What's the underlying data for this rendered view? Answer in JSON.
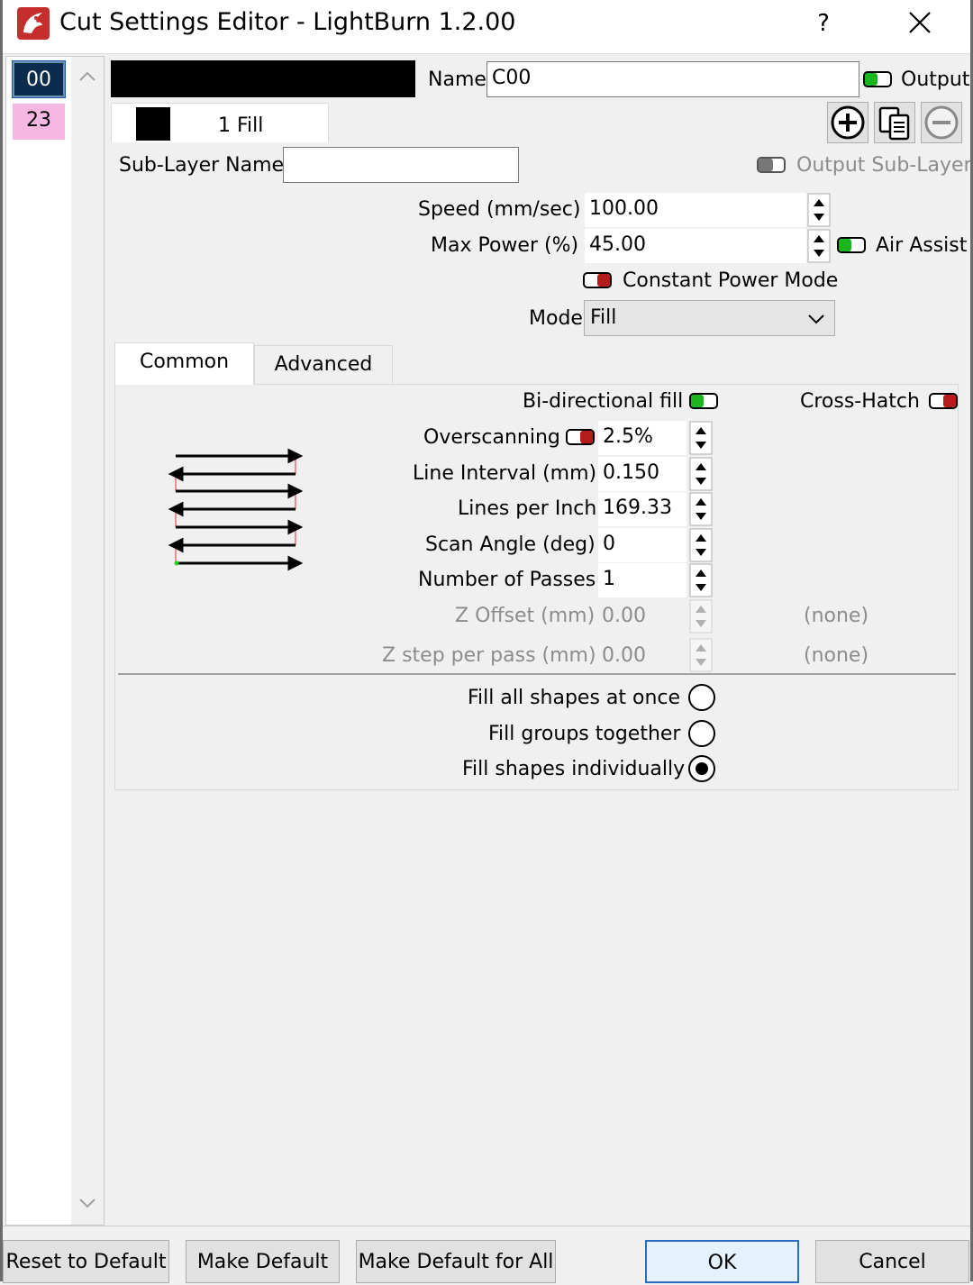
{
  "window": {
    "title": "Cut Settings Editor - LightBurn 1.2.00",
    "help_label": "?"
  },
  "layers": [
    {
      "label": "00",
      "color": "#0c2c4d",
      "selected": true
    },
    {
      "label": "23",
      "color": "#f6b8e3",
      "selected": false
    }
  ],
  "layer_header": {
    "swatch_color": "#000000",
    "name_label": "Name",
    "name_value": "C00",
    "output_label": "Output",
    "output_on": true
  },
  "sublayer": {
    "tab_label": "1 Fill",
    "name_label": "Sub-Layer Name",
    "name_value": "",
    "output_label": "Output Sub-Layer",
    "output_enabled": false,
    "buttons": [
      "add-sublayer-icon",
      "copy-sublayer-icon",
      "remove-sublayer-icon"
    ]
  },
  "settings": {
    "speed_label": "Speed (mm/sec)",
    "speed_value": "100.00",
    "max_power_label": "Max Power (%)",
    "max_power_value": "45.00",
    "air_assist_label": "Air Assist",
    "air_assist_on": true,
    "constant_power_label": "Constant Power Mode",
    "constant_power_on": false,
    "mode_label": "Mode",
    "mode_value": "Fill"
  },
  "tabs": [
    {
      "label": "Common",
      "active": true
    },
    {
      "label": "Advanced",
      "active": false
    }
  ],
  "common": {
    "bidirectional_label": "Bi-directional fill",
    "bidirectional_on": true,
    "crosshatch_label": "Cross-Hatch",
    "crosshatch_on": false,
    "overscanning_label": "Overscanning",
    "overscanning_on": false,
    "overscanning_value": "2.5%",
    "line_interval_label": "Line Interval (mm)",
    "line_interval_value": "0.150",
    "lpi_label": "Lines per Inch",
    "lpi_value": "169.33",
    "scan_angle_label": "Scan Angle (deg)",
    "scan_angle_value": "0",
    "passes_label": "Number of Passes",
    "passes_value": "1",
    "z_offset_label": "Z Offset (mm)",
    "z_offset_value": "0.00",
    "z_offset_suffix": "(none)",
    "z_step_label": "Z step per pass (mm)",
    "z_step_value": "0.00",
    "z_step_suffix": "(none)",
    "fill_options": [
      {
        "label": "Fill all shapes at once",
        "checked": false
      },
      {
        "label": "Fill groups together",
        "checked": false
      },
      {
        "label": "Fill shapes individually",
        "checked": true
      }
    ]
  },
  "footer": {
    "reset_label": "Reset to Default",
    "make_default_label": "Make Default",
    "make_default_all_label": "Make Default for All",
    "ok_label": "OK",
    "cancel_label": "Cancel"
  },
  "colors": {
    "toggle_on": "#1db51d",
    "toggle_off": "#b51b1b",
    "accent": "#2a6ec4"
  }
}
